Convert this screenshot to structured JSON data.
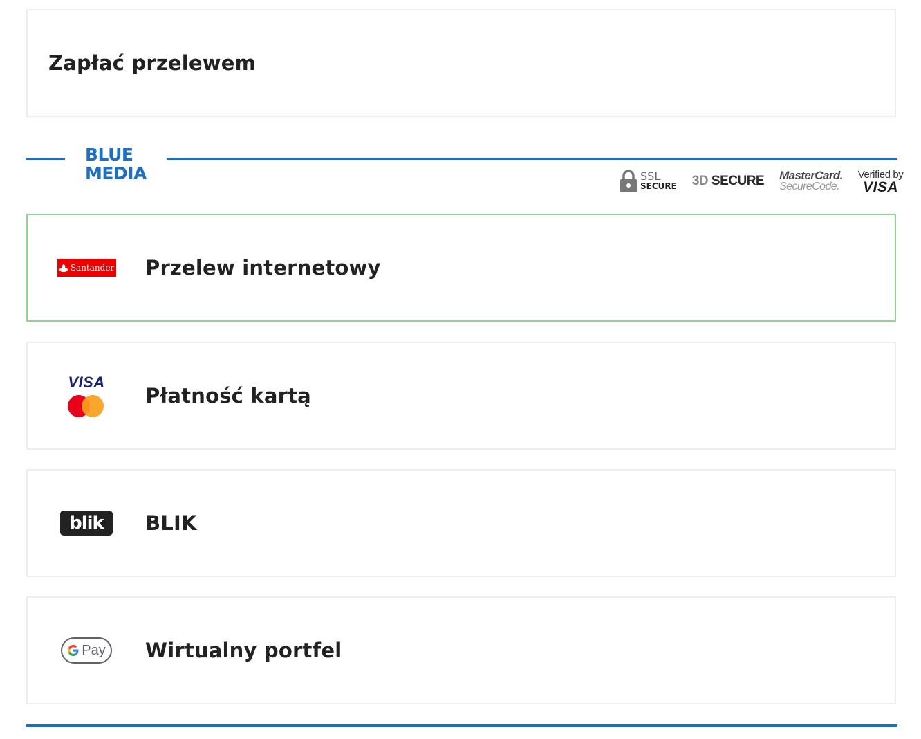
{
  "transfer_option": {
    "label": "Zapłać przelewem"
  },
  "provider": {
    "logo_line1": "BLUE",
    "logo_line2": "MEDIA",
    "accent_color": "#1b6fc4"
  },
  "security_badges": {
    "ssl_top": "SSL",
    "ssl_bottom": "SECURE",
    "three_d_prefix": "3D",
    "three_d_suffix": "SECURE",
    "mastercard_line1": "MasterCard.",
    "mastercard_line2": "SecureCode.",
    "visa_line1": "Verified by",
    "visa_line2": "VISA"
  },
  "payment_methods": [
    {
      "label": "Przelew internetowy",
      "logo": "santander-logo",
      "logo_text": "Santander",
      "selected": true
    },
    {
      "label": "Płatność kartą",
      "logo": "visa-mastercard-logo",
      "logo_text": "VISA",
      "selected": false
    },
    {
      "label": "BLIK",
      "logo": "blik-logo",
      "logo_text": "blik",
      "selected": false
    },
    {
      "label": "Wirtualny portfel",
      "logo": "gpay-logo",
      "logo_text": "Pay",
      "selected": false
    }
  ]
}
